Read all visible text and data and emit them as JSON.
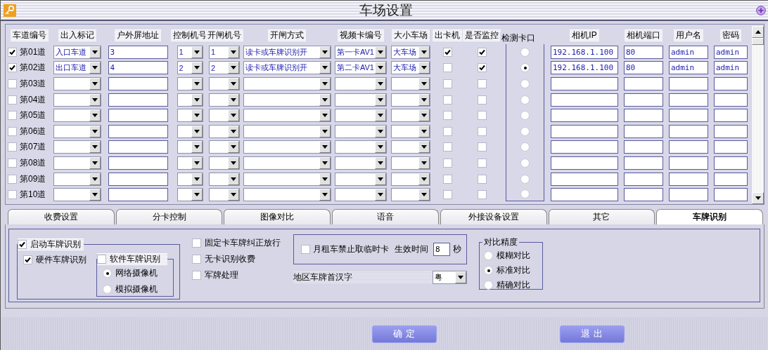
{
  "window": {
    "title": "车场设置"
  },
  "lanes": {
    "columns": [
      "车道编号",
      "出入标记",
      "户外屏地址",
      "控制机号",
      "开闸机号",
      "开闸方式",
      "视频卡编号",
      "大小车场",
      "出卡机",
      "是否监控",
      "检测卡口",
      "相机IP",
      "相机端口",
      "用户名",
      "密码"
    ],
    "rows": [
      {
        "checked": true,
        "lane": "第01道",
        "direction": "入口车道",
        "screen_address": "3",
        "controller": "1",
        "gate": "1",
        "open_mode": "读卡或车牌识别开",
        "video_card": "第一卡AV1",
        "lot": "大车场",
        "dispenser": true,
        "monitored": true,
        "selected": false,
        "ip": "192.168.1.100",
        "port": "80",
        "user": "admin",
        "password": "admin"
      },
      {
        "checked": true,
        "lane": "第02道",
        "direction": "出口车道",
        "screen_address": "4",
        "controller": "2",
        "gate": "2",
        "open_mode": "读卡或车牌识别开",
        "video_card": "第二卡AV1",
        "lot": "大车场",
        "dispenser": false,
        "monitored": true,
        "selected": true,
        "ip": "192.168.1.100",
        "port": "80",
        "user": "admin",
        "password": "admin"
      },
      {
        "checked": false,
        "lane": "第03道",
        "dispenser": false,
        "monitored": false,
        "selected": false
      },
      {
        "checked": false,
        "lane": "第04道",
        "dispenser": false,
        "monitored": false,
        "selected": false
      },
      {
        "checked": false,
        "lane": "第05道",
        "dispenser": false,
        "monitored": false,
        "selected": false
      },
      {
        "checked": false,
        "lane": "第06道",
        "dispenser": false,
        "monitored": false,
        "selected": false
      },
      {
        "checked": false,
        "lane": "第07道",
        "dispenser": false,
        "monitored": false,
        "selected": false
      },
      {
        "checked": false,
        "lane": "第08道",
        "dispenser": false,
        "monitored": false,
        "selected": false
      },
      {
        "checked": false,
        "lane": "第09道",
        "dispenser": false,
        "monitored": false,
        "selected": false
      },
      {
        "checked": false,
        "lane": "第10道",
        "dispenser": false,
        "monitored": false,
        "selected": false
      }
    ]
  },
  "tabs": [
    {
      "label": "收费设置",
      "selected": false
    },
    {
      "label": "分卡控制",
      "selected": false
    },
    {
      "label": "图像对比",
      "selected": false
    },
    {
      "label": "语音",
      "selected": false
    },
    {
      "label": "外接设备设置",
      "selected": false
    },
    {
      "label": "其它",
      "selected": false
    },
    {
      "label": "车牌识别",
      "selected": true
    }
  ],
  "plate_recognition": {
    "enable": {
      "label": "启动车牌识别",
      "checked": true
    },
    "hardware": {
      "label": "硬件车牌识别",
      "checked": true
    },
    "software": {
      "label": "软件车牌识别",
      "checked": false
    },
    "camera_types": [
      {
        "label": "网络摄像机",
        "selected": true
      },
      {
        "label": "模拟摄像机",
        "selected": false
      }
    ],
    "options": [
      {
        "label": "固定卡车牌纠正放行",
        "checked": false
      },
      {
        "label": "无卡识别收费",
        "checked": false
      },
      {
        "label": "军牌处理",
        "checked": false
      }
    ],
    "monthly": {
      "label": "月租车禁止取临时卡",
      "checked": false,
      "effective_label": "生效时间",
      "effective_value": "8",
      "unit": "秒"
    },
    "region": {
      "label": "地区车牌首汉字",
      "value": "粤"
    },
    "precision": {
      "title": "对比精度",
      "options": [
        {
          "label": "模糊对比",
          "selected": false
        },
        {
          "label": "标准对比",
          "selected": true
        },
        {
          "label": "精确对比",
          "selected": false
        }
      ]
    }
  },
  "buttons": [
    "确 定",
    "退 出"
  ]
}
